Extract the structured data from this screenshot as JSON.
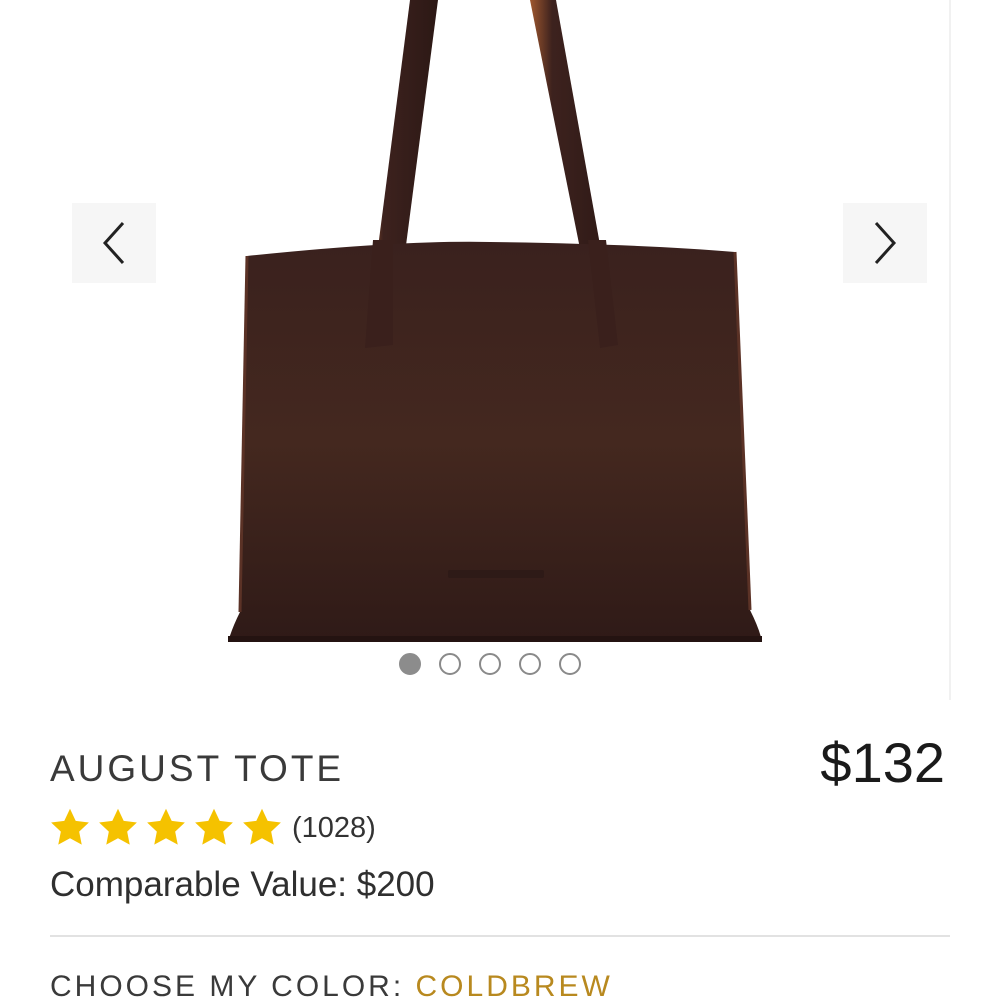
{
  "gallery": {
    "prev_icon": "chevron-left-icon",
    "next_icon": "chevron-right-icon",
    "image_count": 5,
    "active_index": 0,
    "bag_color": "#3f2421",
    "strap_edge_color": "#a0582f"
  },
  "product": {
    "title": "AUGUST TOTE",
    "price": "$132",
    "rating_stars": 5,
    "star_color": "#f5c200",
    "review_count": "(1028)",
    "comparable_value": "Comparable Value: $200"
  },
  "color_selector": {
    "label": "CHOOSE MY COLOR: ",
    "selected": "COLDBREW",
    "accent_color": "#b8891f"
  }
}
